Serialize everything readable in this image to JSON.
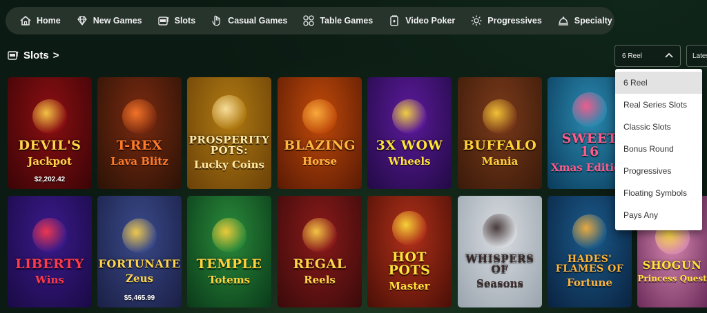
{
  "nav": {
    "items": [
      {
        "label": "Home",
        "icon": "house-icon"
      },
      {
        "label": "New Games",
        "icon": "diamond-icon"
      },
      {
        "label": "Slots",
        "icon": "slot-machine-icon"
      },
      {
        "label": "Casual Games",
        "icon": "hand-icon"
      },
      {
        "label": "Table Games",
        "icon": "chips-icon"
      },
      {
        "label": "Video Poker",
        "icon": "cards-icon"
      },
      {
        "label": "Progressives",
        "icon": "sparkle-icon"
      },
      {
        "label": "Specialty",
        "icon": "cloche-icon"
      }
    ]
  },
  "section": {
    "title": "Slots",
    "chevron": ">"
  },
  "filter": {
    "selected": "6 Reel",
    "sort_label": "Lates",
    "options": [
      "6 Reel",
      "Real Series Slots",
      "Classic Slots",
      "Bonus Round",
      "Progressives",
      "Floating Symbols",
      "Pays Any"
    ]
  },
  "games": [
    {
      "title": "Devil's",
      "sub": "Jackpot",
      "jackpot": "$2,202.42",
      "bg": "#8a0f12",
      "bg2": "#3b0406",
      "color": "#ffd54a"
    },
    {
      "title": "T-Rex",
      "sub": "Lava Blitz",
      "jackpot": "",
      "bg": "#7a2a10",
      "bg2": "#2a1206",
      "color": "#ff7a2a"
    },
    {
      "title": "Prosperity Pots:",
      "sub": "Lucky Coins",
      "jackpot": "",
      "bg": "#b07a12",
      "bg2": "#6a4108",
      "color": "#ffe9a8"
    },
    {
      "title": "Blazing",
      "sub": "Horse",
      "jackpot": "",
      "bg": "#c04a0a",
      "bg2": "#5a1a04",
      "color": "#ffb340"
    },
    {
      "title": "3x Wow",
      "sub": "Wheels",
      "jackpot": "",
      "bg": "#5b1a9a",
      "bg2": "#220a45",
      "color": "#ffe23a"
    },
    {
      "title": "Buffalo",
      "sub": "Mania",
      "jackpot": "",
      "bg": "#7a3a1a",
      "bg2": "#3a1a0a",
      "color": "#ffcf3a"
    },
    {
      "title": "Sweet 16",
      "sub": "Xmas Edition",
      "jackpot": "",
      "bg": "#2a8ab0",
      "bg2": "#0a3a5a",
      "color": "#ff5a8a"
    },
    {
      "title": "Liberty",
      "sub": "Wins",
      "jackpot": "",
      "bg": "#3a1a8a",
      "bg2": "#1a0a45",
      "color": "#ff3a4a"
    },
    {
      "title": "Fortunate",
      "sub": "Zeus",
      "jackpot": "$5,465.99",
      "bg": "#3a4a8a",
      "bg2": "#1a1f45",
      "color": "#ffd54a"
    },
    {
      "title": "Temple",
      "sub": "Totems",
      "jackpot": "",
      "bg": "#2a8a3a",
      "bg2": "#0a3a1a",
      "color": "#ffd23a"
    },
    {
      "title": "Regal",
      "sub": "Reels",
      "jackpot": "",
      "bg": "#8a1a1a",
      "bg2": "#3a0a0a",
      "color": "#ffd54a"
    },
    {
      "title": "Hot Pots",
      "sub": "Master",
      "jackpot": "",
      "bg": "#b0301a",
      "bg2": "#4a0f06",
      "color": "#ffe23a"
    },
    {
      "title": "Whispers of",
      "sub": "Seasons",
      "jackpot": "",
      "bg": "#d8dce0",
      "bg2": "#9aa4ae",
      "color": "#3a2a2a"
    },
    {
      "title": "Hades' Flames of",
      "sub": "Fortune",
      "jackpot": "",
      "bg": "#1a5a8a",
      "bg2": "#0a2240",
      "color": "#ffb33a"
    },
    {
      "title": "Shogun",
      "sub": "Princess Quest",
      "jackpot": "",
      "bg": "#d88ab0",
      "bg2": "#6a2a5a",
      "color": "#ffe23a"
    }
  ]
}
